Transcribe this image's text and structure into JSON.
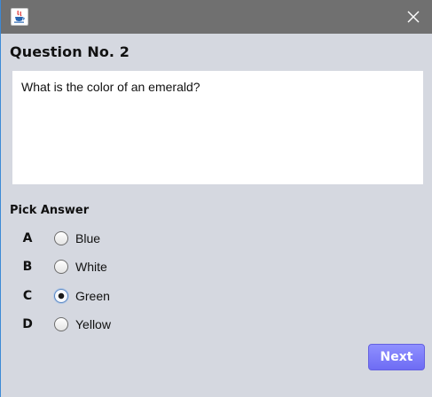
{
  "window": {
    "app_icon": "java-coffee-cup-icon",
    "close_icon": "close-icon"
  },
  "question": {
    "title": "Question No. 2",
    "text": "What is the color of an emerald?"
  },
  "answers": {
    "label": "Pick Answer",
    "selected": "C",
    "options": [
      {
        "letter": "A",
        "text": "Blue",
        "checked": false
      },
      {
        "letter": "B",
        "text": "White",
        "checked": false
      },
      {
        "letter": "C",
        "text": "Green",
        "checked": true
      },
      {
        "letter": "D",
        "text": "Yellow",
        "checked": false
      }
    ]
  },
  "actions": {
    "next_label": "Next"
  },
  "colors": {
    "title_bar": "#707070",
    "window_bg": "#d5d8e0",
    "next_button": "#7d7cfb"
  }
}
